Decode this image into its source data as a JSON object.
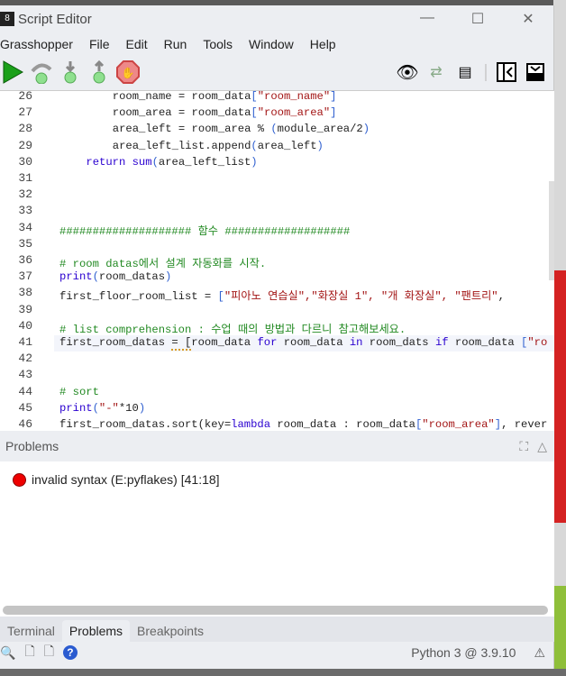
{
  "window": {
    "title": "Script Editor",
    "minimize": "—",
    "maximize": "☐",
    "close": "✕"
  },
  "menu": [
    "Grasshopper",
    "File",
    "Edit",
    "Run",
    "Tools",
    "Window",
    "Help"
  ],
  "editor": {
    "lines": [
      {
        "n": "26",
        "i": 8,
        "t": [
          [
            "room_name = room_data",
            ""
          ],
          [
            "[",
            "br"
          ],
          [
            "\"room_name\"",
            "st"
          ],
          [
            "]",
            "br"
          ]
        ]
      },
      {
        "n": "27",
        "i": 8,
        "t": [
          [
            "room_area = room_data",
            ""
          ],
          [
            "[",
            "br"
          ],
          [
            "\"room_area\"",
            "st"
          ],
          [
            "]",
            "br"
          ]
        ]
      },
      {
        "n": "28",
        "i": 8,
        "t": [
          [
            "area_left = room_area % ",
            ""
          ],
          [
            "(",
            "br"
          ],
          [
            "module_area/2",
            ""
          ],
          [
            ")",
            "br"
          ]
        ]
      },
      {
        "n": "29",
        "i": 8,
        "t": [
          [
            "area_left_list.append",
            ""
          ],
          [
            "(",
            "br"
          ],
          [
            "area_left",
            ""
          ],
          [
            ")",
            "br"
          ]
        ]
      },
      {
        "n": "30",
        "i": 4,
        "t": [
          [
            "return",
            "kw"
          ],
          [
            " ",
            ""
          ],
          [
            "sum",
            "kw"
          ],
          [
            "(",
            "br"
          ],
          [
            "area_left_list",
            ""
          ],
          [
            ")",
            "br"
          ]
        ]
      },
      {
        "n": "31",
        "i": 0,
        "t": []
      },
      {
        "n": "32",
        "i": 0,
        "t": []
      },
      {
        "n": "33",
        "i": 0,
        "t": []
      },
      {
        "n": "34",
        "i": 0,
        "t": [
          [
            "#################### 함수 ###################",
            "cm"
          ]
        ]
      },
      {
        "n": "35",
        "i": 0,
        "t": []
      },
      {
        "n": "36",
        "i": 0,
        "t": [
          [
            "# room datas에서 설계 자동화를 시작.",
            "cm"
          ]
        ]
      },
      {
        "n": "37",
        "i": 0,
        "t": [
          [
            "print",
            "kw"
          ],
          [
            "(",
            "br"
          ],
          [
            "room_datas",
            ""
          ],
          [
            ")",
            "br"
          ]
        ]
      },
      {
        "n": "38",
        "i": 0,
        "t": [
          [
            "first_floor_room_list = ",
            ""
          ],
          [
            "[",
            "br"
          ],
          [
            "\"피아노 연습실\",\"화장실 1\", \"개 화장실\", \"팬트리\"",
            "st"
          ],
          [
            ", ",
            ""
          ]
        ]
      },
      {
        "n": "39",
        "i": 0,
        "t": []
      },
      {
        "n": "40",
        "i": 0,
        "t": [
          [
            "# list comprehension : 수업 때의 방법과 다르니 참고해보세요.",
            "cm"
          ]
        ]
      },
      {
        "n": "41",
        "i": 0,
        "t": [
          [
            "first_room_datas ",
            ""
          ],
          [
            "= [",
            "sq"
          ],
          [
            "room_data ",
            ""
          ],
          [
            "for",
            "kw"
          ],
          [
            " room_data ",
            ""
          ],
          [
            "in",
            "kw"
          ],
          [
            " room_dats ",
            ""
          ],
          [
            "if",
            "kw"
          ],
          [
            " room_data ",
            ""
          ],
          [
            "[",
            "br"
          ],
          [
            "\"ro",
            "st"
          ]
        ]
      },
      {
        "n": "42",
        "i": 0,
        "t": []
      },
      {
        "n": "43",
        "i": 0,
        "t": []
      },
      {
        "n": "44",
        "i": 0,
        "t": [
          [
            "# sort",
            "cm"
          ]
        ]
      },
      {
        "n": "45",
        "i": 0,
        "t": [
          [
            "print",
            "kw"
          ],
          [
            "(",
            "br"
          ],
          [
            "\"-\"",
            "st"
          ],
          [
            "*10",
            ""
          ],
          [
            ")",
            "br"
          ]
        ]
      },
      {
        "n": "46",
        "i": 0,
        "t": [
          [
            "first_room_datas.sort(key=",
            ""
          ],
          [
            "lambda",
            "kw"
          ],
          [
            " room_data : room_data",
            ""
          ],
          [
            "[",
            "br"
          ],
          [
            "\"room_area\"",
            "st"
          ],
          [
            "]",
            "br"
          ],
          [
            ", rever",
            ""
          ]
        ]
      }
    ]
  },
  "problems": {
    "title": "Problems",
    "error": "invalid syntax (E:pyflakes) [41:18]"
  },
  "tabs": [
    "Terminal",
    "Problems",
    "Breakpoints"
  ],
  "status": {
    "python": "Python 3 @ 3.9.10"
  },
  "colors": {
    "run": "#1aa01a",
    "error": "#e00000"
  }
}
